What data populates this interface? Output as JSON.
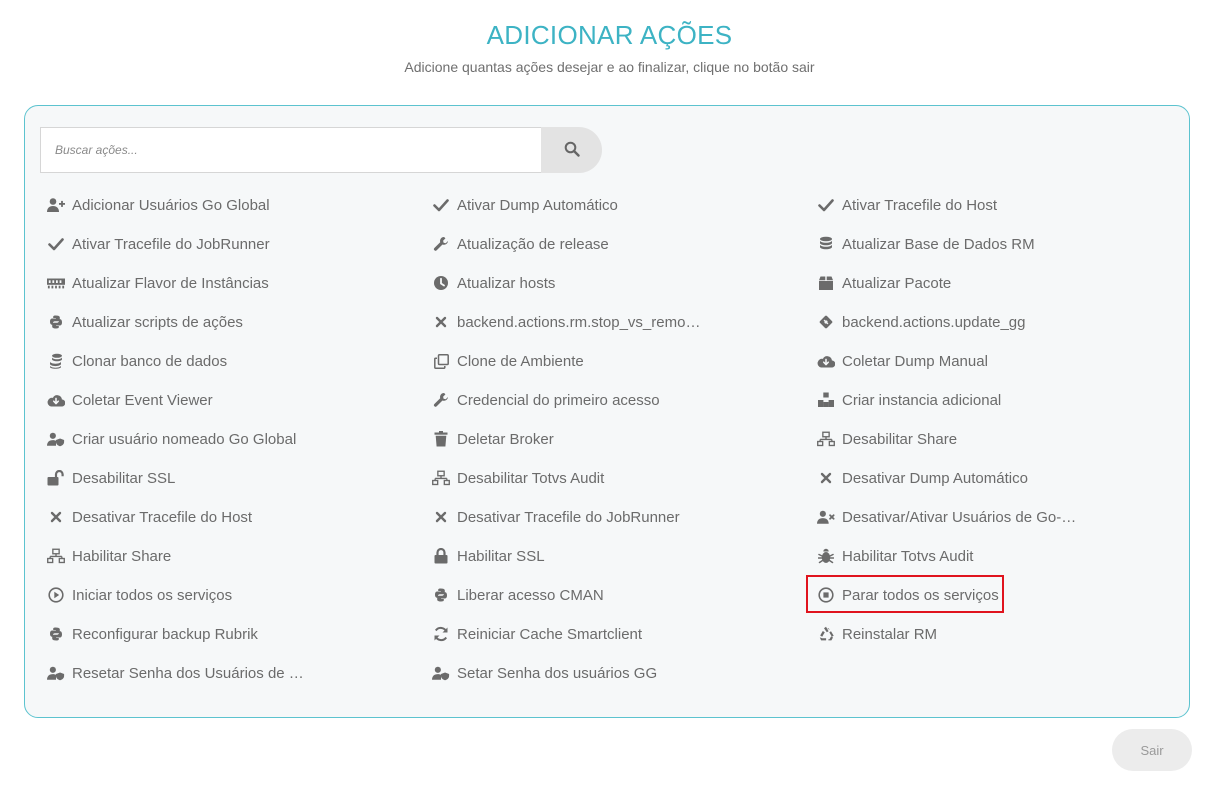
{
  "header": {
    "title": "ADICIONAR AÇÕES",
    "subtitle": "Adicione quantas ações desejar e ao finalizar, clique no botão sair"
  },
  "search": {
    "placeholder": "Buscar ações...",
    "value": "",
    "button_icon": "search-icon"
  },
  "actions": [
    {
      "label": "Adicionar Usuários Go Global",
      "icon": "user-plus-icon"
    },
    {
      "label": "Ativar Dump Automático",
      "icon": "check-icon"
    },
    {
      "label": "Ativar Tracefile do Host",
      "icon": "check-icon"
    },
    {
      "label": "Ativar Tracefile do JobRunner",
      "icon": "check-icon"
    },
    {
      "label": "Atualização de release",
      "icon": "wrench-icon"
    },
    {
      "label": "Atualizar Base de Dados RM",
      "icon": "database-icon"
    },
    {
      "label": "Atualizar Flavor de Instâncias",
      "icon": "memory-icon"
    },
    {
      "label": "Atualizar hosts",
      "icon": "clock-icon"
    },
    {
      "label": "Atualizar Pacote",
      "icon": "box-icon"
    },
    {
      "label": "Atualizar scripts de ações",
      "icon": "python-icon"
    },
    {
      "label": "backend.actions.rm.stop_vs_remo…",
      "icon": "times-icon"
    },
    {
      "label": "backend.actions.update_gg",
      "icon": "git-icon"
    },
    {
      "label": "Clonar banco de dados",
      "icon": "database-copy-icon"
    },
    {
      "label": "Clone de Ambiente",
      "icon": "clone-icon"
    },
    {
      "label": "Coletar Dump Manual",
      "icon": "cloud-download-icon"
    },
    {
      "label": "Coletar Event Viewer",
      "icon": "cloud-download-icon"
    },
    {
      "label": "Credencial do primeiro acesso",
      "icon": "wrench-icon"
    },
    {
      "label": "Criar instancia adicional",
      "icon": "cubes-icon"
    },
    {
      "label": "Criar usuário nomeado Go Global",
      "icon": "user-shield-icon"
    },
    {
      "label": "Deletar Broker",
      "icon": "trash-icon"
    },
    {
      "label": "Desabilitar Share",
      "icon": "network-icon"
    },
    {
      "label": "Desabilitar SSL",
      "icon": "unlock-icon"
    },
    {
      "label": "Desabilitar Totvs Audit",
      "icon": "network-icon"
    },
    {
      "label": "Desativar Dump Automático",
      "icon": "times-icon"
    },
    {
      "label": "Desativar Tracefile do Host",
      "icon": "times-icon"
    },
    {
      "label": "Desativar Tracefile do JobRunner",
      "icon": "times-icon"
    },
    {
      "label": "Desativar/Ativar Usuários de Go-…",
      "icon": "user-times-icon"
    },
    {
      "label": "Habilitar Share",
      "icon": "network-icon"
    },
    {
      "label": "Habilitar SSL",
      "icon": "lock-icon"
    },
    {
      "label": "Habilitar Totvs Audit",
      "icon": "bug-icon"
    },
    {
      "label": "Iniciar todos os serviços",
      "icon": "play-circle-icon"
    },
    {
      "label": "Liberar acesso CMAN",
      "icon": "python-icon"
    },
    {
      "label": "Parar todos os serviços",
      "icon": "stop-circle-icon"
    },
    {
      "label": "Reconfigurar backup Rubrik",
      "icon": "python-icon"
    },
    {
      "label": "Reiniciar Cache Smartclient",
      "icon": "sync-icon"
    },
    {
      "label": "Reinstalar RM",
      "icon": "recycle-icon"
    },
    {
      "label": "Resetar Senha dos Usuários de …",
      "icon": "user-shield-icon"
    },
    {
      "label": "Setar Senha dos usuários GG",
      "icon": "user-shield-icon"
    }
  ],
  "footer": {
    "exit_label": "Sair"
  },
  "colors": {
    "accent": "#3db3c4",
    "panel_border": "#5cc3cf",
    "highlight": "#e0141e"
  }
}
